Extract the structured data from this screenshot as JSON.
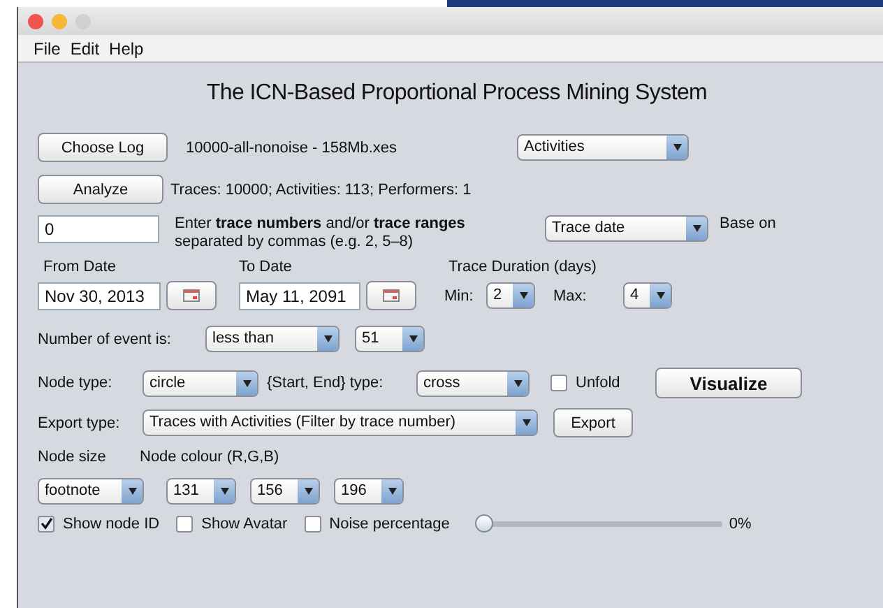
{
  "menu": [
    "File",
    "Edit",
    "Help"
  ],
  "title": "The ICN-Based Proportional Process Mining System",
  "log": {
    "button": "Choose Log",
    "file": "10000-all-nonoise - 158Mb.xes",
    "view": "Activities"
  },
  "analyze": {
    "button": "Analyze",
    "summary": "Traces: 10000; Activities: 113; Performers: 1"
  },
  "filter": {
    "value": "0",
    "hint": "Enter **trace numbers** and/or **trace ranges**",
    "hint2": "separated by commas (e.g. 2, 5–8)",
    "mode": "Trace date",
    "base_label": "Base on"
  },
  "dates": {
    "from_label": "From Date",
    "from": "Nov 30, 2013",
    "to_label": "To Date",
    "to": "May 11, 2091",
    "duration_label": "Trace Duration (days)",
    "min_label": "Min:",
    "min": "2",
    "max_label": "Max:",
    "max": "4"
  },
  "events": {
    "label": "Number of event is:",
    "op": "less than",
    "count": "51"
  },
  "node": {
    "label": "Node type:",
    "type": "circle",
    "se_label": "{Start, End} type:",
    "se_type": "cross",
    "unfold_label": "Unfold",
    "unfold": false,
    "visualize": "Visualize"
  },
  "export": {
    "label": "Export type:",
    "type": "Traces with Activities (Filter by trace number)",
    "button": "Export"
  },
  "size": {
    "size_label": "Node size",
    "colour_label": "Node colour (R,G,B)",
    "size": "footnote",
    "rgb": [
      "131",
      "156",
      "196"
    ]
  },
  "options": [
    {
      "label": "Show node ID",
      "checked": true
    },
    {
      "label": "Show Avatar",
      "checked": false
    },
    {
      "label": "Noise percentage",
      "checked": false
    }
  ],
  "noise": {
    "level": 0,
    "reading": "0%"
  }
}
